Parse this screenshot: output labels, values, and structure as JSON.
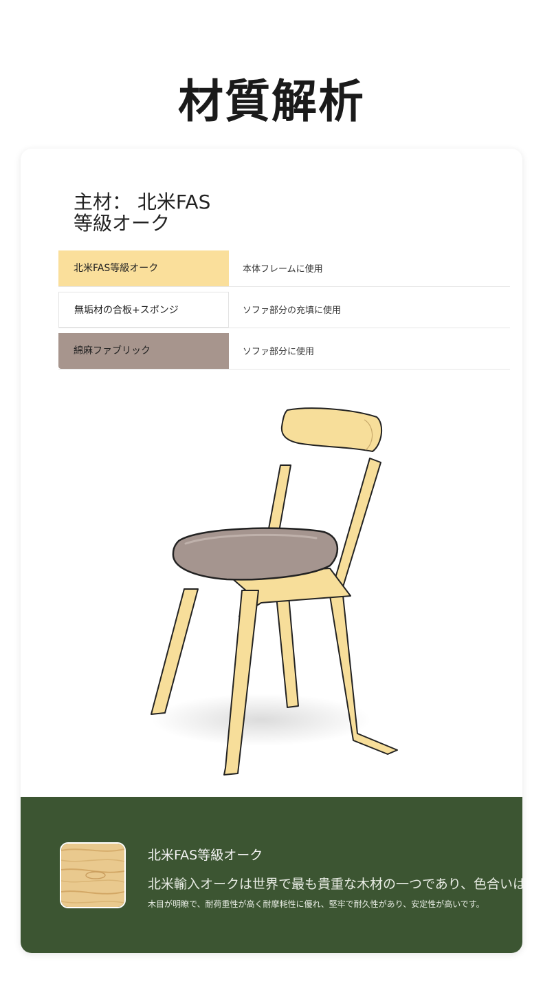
{
  "page": {
    "title": "材質解析"
  },
  "main_material": {
    "heading": "主材： 北米FAS等級オーク"
  },
  "materials": [
    {
      "name": "北米FAS等級オーク",
      "usage": "本体フレームに使用",
      "color": "#fadf9b"
    },
    {
      "name": "無垢材の合板+スポンジ",
      "usage": "ソファ部分の充填に使用",
      "color": "#ffffff"
    },
    {
      "name": "綿麻ファブリック",
      "usage": "ソファ部分に使用",
      "color": "#a7958d"
    }
  ],
  "feature": {
    "title": "北米FAS等級オーク",
    "lead": "北米輸入オークは世界で最も貴重な木材の一つであり、色合いは淡い",
    "body": "木目が明瞭で、耐荷重性が高く耐摩耗性に優れ、堅牢で耐久性があり、安定性が高いです。",
    "panel_color": "#3c5532"
  }
}
